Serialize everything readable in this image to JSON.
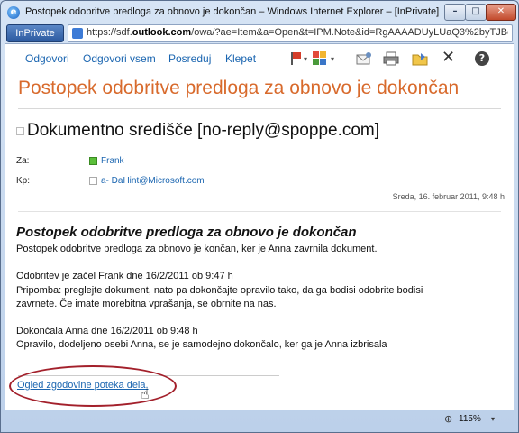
{
  "window": {
    "title": "Postopek odobritve predloga za obnovo je dokončan – Windows Internet Explorer – [InPrivate]",
    "min_symbol": "–",
    "max_symbol": "□",
    "close_symbol": "✕"
  },
  "address": {
    "inprivate_label": "InPrivate",
    "url_prefix": "https://sdf.",
    "url_domain": "outlook.com",
    "url_rest": "/owa/?ae=Item&a=Open&t=IPM.Note&id=RgAAAADUyLUaQ3%2byTJBdVM"
  },
  "toolbar": {
    "reply_label": "Odgovori",
    "reply_all_label": "Odgovori vsem",
    "forward_label": "Posreduj",
    "chat_label": "Klepet",
    "dropdown_symbol": "▾",
    "delete_symbol": "✕",
    "help_symbol": "?",
    "icons": [
      "flag-icon",
      "categories-icon",
      "envelope-icon",
      "printer-icon",
      "move-to-folder-icon",
      "delete-icon",
      "help-icon"
    ]
  },
  "message": {
    "subject": "Postopek odobritve predloga za obnovo je dokončan",
    "sender": "Dokumentno središče [no-reply@spoppe.com]",
    "to_label": "Za:",
    "to_value": "Frank",
    "cc_label": "Kp:",
    "cc_value": "a- DaHint@Microsoft.com",
    "date": "Sreda, 16. februar 2011, 9:48 h"
  },
  "body": {
    "title": "Postopek odobritve predloga za obnovo je dokončan",
    "line1": "Postopek odobritve predloga za obnovo je končan, ker je Anna zavrnila dokument.",
    "line2": "Odobritev je začel Frank dne 16/2/2011 ob 9:47 h",
    "line3": "Pripomba: preglejte dokument, nato pa dokončajte opravilo tako, da ga bodisi odobrite bodisi",
    "line4": "zavrnete. Če imate morebitna vprašanja, se obrnite na nas.",
    "line5": "Dokončala Anna dne 16/2/2011 ob 9:48 h",
    "line6": "Opravilo, dodeljeno osebi Anna, se je samodejno dokončalo, ker ga je Anna izbrisala",
    "history_link": "Ogled zgodovine poteka dela.",
    "cursor_symbol": "☝"
  },
  "status": {
    "zoom_symbol": "⊕",
    "zoom": "115%",
    "dropdown_symbol": "▾"
  },
  "colors": {
    "subject": "#d86a2c",
    "link": "#1a65b0",
    "highlight": "#a3202b"
  }
}
